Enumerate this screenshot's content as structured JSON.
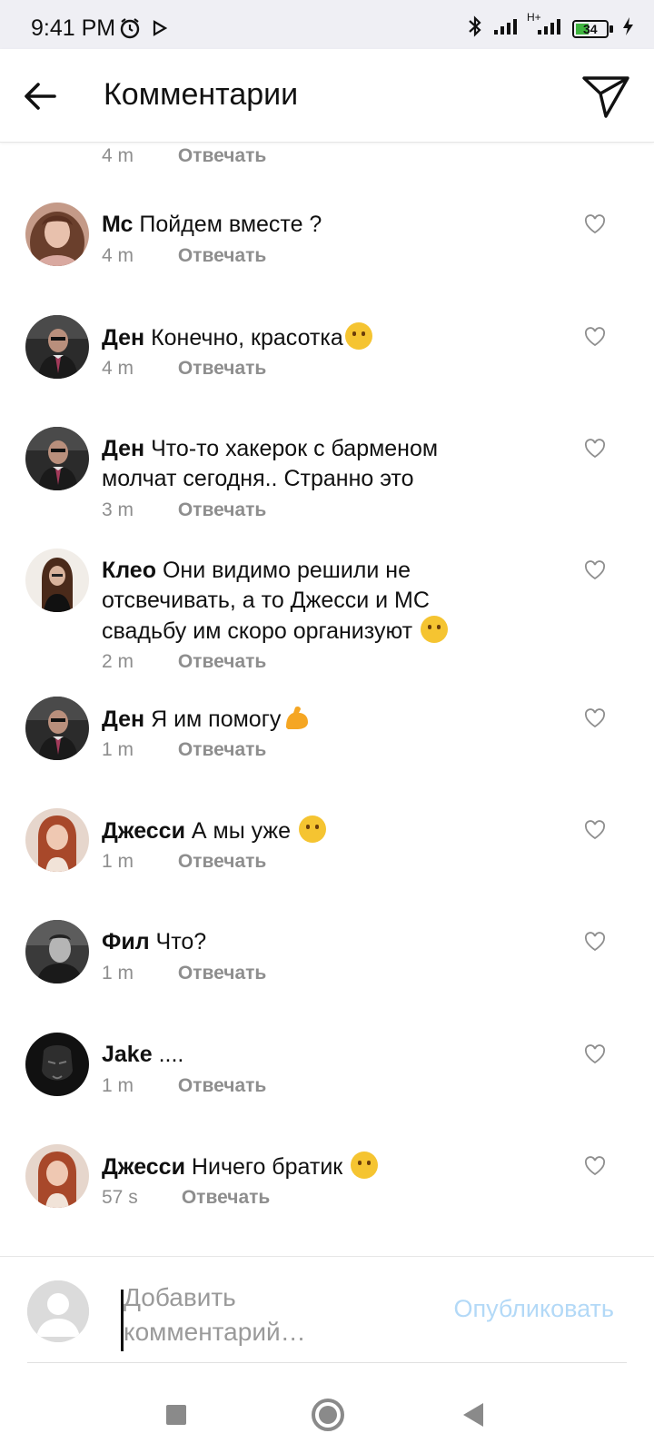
{
  "status_bar": {
    "time": "9:41 PM",
    "network": "H+",
    "battery": "34"
  },
  "header": {
    "title": "Комментарии"
  },
  "reply_label": "Отвечать",
  "partial_comment": {
    "time": "4 m"
  },
  "comments": [
    {
      "user": "Мс",
      "text": "Пойдем вместе ?",
      "time": "4 m"
    },
    {
      "user": "Ден",
      "text": "Конечно, красотка",
      "emoji": "wink",
      "time": "4 m"
    },
    {
      "user": "Ден",
      "text": "Что-то хакерок с барменом молчат сегодня.. Странно это",
      "time": "3 m"
    },
    {
      "user": "Клео",
      "text": "Они видимо решили не отсвечивать, а то Джесси и МС свадьбу им скоро организуют",
      "emoji": "joy",
      "time": "2 m"
    },
    {
      "user": "Ден",
      "text": "Я им помогу",
      "emoji": "muscle",
      "time": "1 m"
    },
    {
      "user": "Джесси",
      "text": "А мы уже",
      "emoji": "hand-over-mouth",
      "time": "1 m"
    },
    {
      "user": "Фил",
      "text": "Что?",
      "time": "1 m"
    },
    {
      "user": "Jake",
      "text": "....",
      "time": "1 m"
    },
    {
      "user": "Джесси",
      "text": "Ничего братик",
      "emoji": "smiling",
      "time": "57 s"
    }
  ],
  "composer": {
    "placeholder": "Добавить комментарий…",
    "publish_label": "Опубликовать"
  },
  "colors": {
    "accent_disabled": "#b3d9f7",
    "secondary_text": "#8e8e8e"
  }
}
